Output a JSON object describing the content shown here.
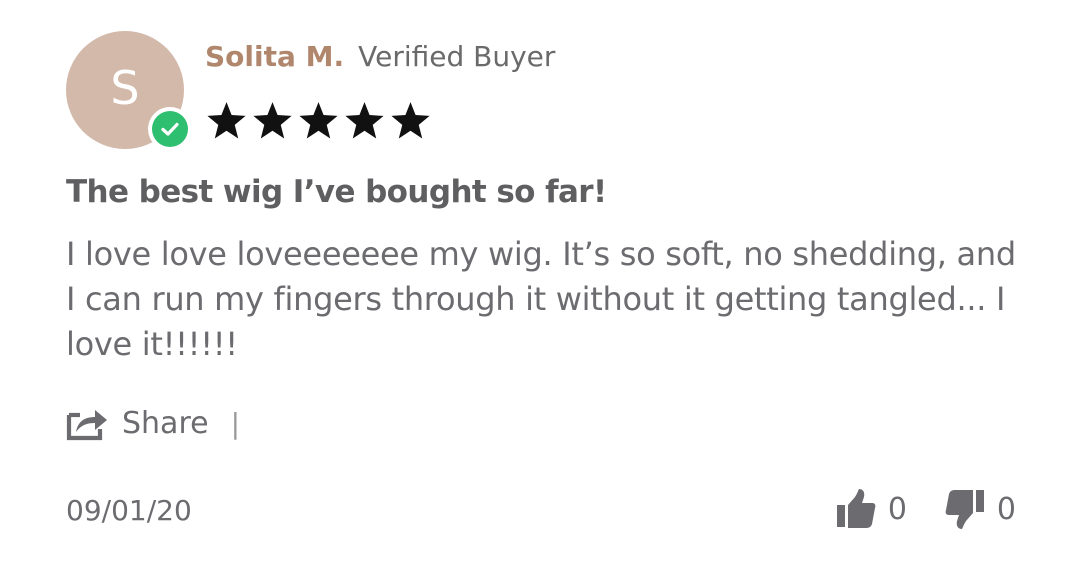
{
  "reviewer": {
    "initial": "S",
    "name": "Solita M.",
    "badge_label": "Verified Buyer",
    "verified_icon": "check-circle-icon"
  },
  "rating": {
    "value": 5,
    "max": 5,
    "star_color": "#111111"
  },
  "review": {
    "title": "The best wig I’ve bought so far!",
    "body": "I love love loveeeeeee my wig. It’s so soft, no shedding, and I can run my fingers through it without it getting tangled... I love it!!!!!!"
  },
  "actions": {
    "share_label": "Share",
    "share_icon": "share-icon",
    "divider": "|"
  },
  "date": "09/01/20",
  "votes": {
    "up_count": "0",
    "down_count": "0",
    "up_icon": "thumbs-up-icon",
    "down_icon": "thumbs-down-icon"
  },
  "colors": {
    "avatar_bg": "#d3b9aa",
    "name": "#b0866d",
    "verified": "#2fbf71",
    "text": "#6c6c70"
  }
}
